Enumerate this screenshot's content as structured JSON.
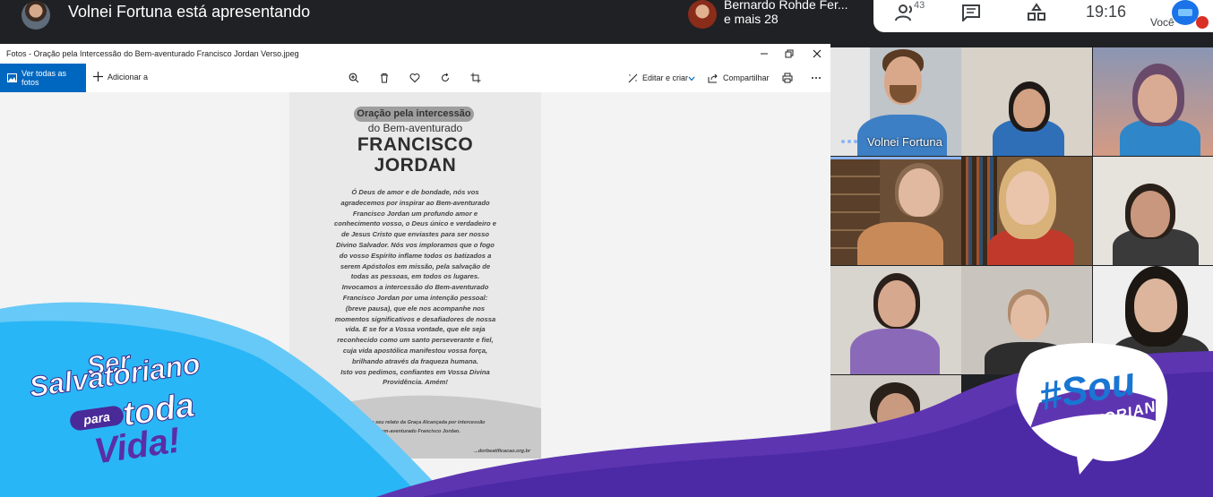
{
  "meet": {
    "presenting_text": "Volnei Fortuna está apresentando",
    "participant_name": "Bernardo Rohde Fer...",
    "participant_more": "e mais 28",
    "people_count": "43",
    "time": "19:16",
    "self_label": "Você"
  },
  "photos": {
    "window_title": "Fotos - Oração pela Intercessão do Bem-aventurado Francisco Jordan Verso.jpeg",
    "ver_todas": "Ver todas as fotos",
    "adicionar": "Adicionar a",
    "editar": "Editar e criar",
    "compartilhar": "Compartilhar"
  },
  "card": {
    "pill": "Oração pela intercessão",
    "subtitle": "do Bem-aventurado",
    "name_line1": "FRANCISCO",
    "name_line2": "JORDAN",
    "prayer_lines": [
      "Ó Deus de amor e de bondade, nós vos",
      "agradecemos por inspirar ao Bem-aventurado",
      "Francisco Jordan um profundo amor e",
      "conhecimento vosso, o Deus único e verdadeiro e",
      "de Jesus Cristo que enviastes para ser nosso",
      "Divino Salvador. Nós vos imploramos que o fogo",
      "do vosso Espírito inflame todos os batizados a",
      "serem Apóstolos em missão, pela salvação de",
      "todas as pessoas, em todos os lugares.",
      "Invocamos a intercessão do Bem-aventurado",
      "Francisco Jordan por uma intenção pessoal:",
      "(breve pausa), que ele nos acompanhe nos",
      "momentos significativos e desafiadores de nossa",
      "vida. E se for a Vossa vontade, que ele seja",
      "reconhecido como um santo perseverante e fiel,",
      "cuja vida apostólica manifestou vossa força,",
      "brilhando através da fraqueza humana.",
      "Isto vos pedimos, confiantes em Vossa Divina",
      "Providência.  Amém!"
    ],
    "footer_line1": "Compartilhe seu relato da Graça Alcançada por intercessão",
    "footer_line2": "do Bem-aventurado Francisco Jordan.",
    "footer_line3": "...dorbeatificacao.org.br"
  },
  "tiles": {
    "speaker_name": "Volnei Fortuna"
  },
  "banner": {
    "ser": "Ser",
    "salvatoriano": "Salvatoriano",
    "para": "para",
    "toda": "toda",
    "vida": "Vida!",
    "sou_hash": "#Sou",
    "sou_word": "SALVATORIANO"
  },
  "colors": {
    "meet_bg": "#202124",
    "accent_blue": "#0067c0",
    "banner_cyan": "#29b6f6",
    "banner_purple": "#5e35b1"
  }
}
